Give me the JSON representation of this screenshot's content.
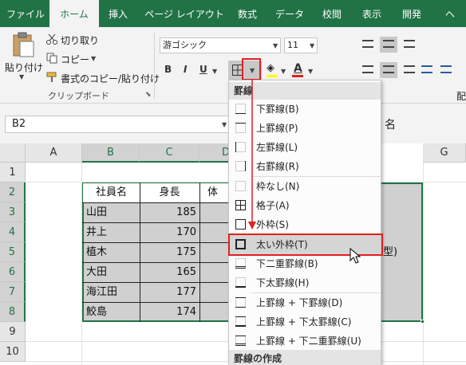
{
  "ribbon_tabs": [
    "ファイル",
    "ホーム",
    "挿入",
    "ページ レイアウト",
    "数式",
    "データ",
    "校閲",
    "表示",
    "開発",
    "ヘ"
  ],
  "clipboard": {
    "paste": "貼り付け",
    "cut": "切り取り",
    "copy": "コピー",
    "format_painter": "書式のコピー/貼り付け",
    "group_label": "クリップボード"
  },
  "font": {
    "name": "游ゴシック",
    "size": "11"
  },
  "font_buttons": {
    "bold": "B",
    "italic": "I",
    "underline": "U",
    "font_color_glyph": "A"
  },
  "name_box": "B2",
  "formula_bar_tail": "名",
  "right_edge_label": "配",
  "columns": [
    "A",
    "B",
    "C",
    "D",
    "G"
  ],
  "rows": [
    "1",
    "2",
    "3",
    "4",
    "5",
    "6",
    "7",
    "8",
    "9",
    "10"
  ],
  "table": {
    "headers": [
      "社員名",
      "身長",
      "体"
    ],
    "names": [
      "山田",
      "井上",
      "植木",
      "大田",
      "海江田",
      "鮫島"
    ],
    "heights": [
      "185",
      "170",
      "175",
      "165",
      "177",
      "174"
    ]
  },
  "sheet_text": {
    "cell_g5_fragment": "型)"
  },
  "border_menu": {
    "header": "罫線",
    "items": [
      {
        "label": "下罫線(B)",
        "icon": "border-bottom-icon"
      },
      {
        "label": "上罫線(P)",
        "icon": "border-top-icon"
      },
      {
        "label": "左罫線(L)",
        "icon": "border-left-icon"
      },
      {
        "label": "右罫線(R)",
        "icon": "border-right-icon"
      },
      {
        "label": "枠なし(N)",
        "icon": "no-border-icon"
      },
      {
        "label": "格子(A)",
        "icon": "all-borders-icon"
      },
      {
        "label": "外枠(S)",
        "icon": "outside-borders-icon"
      },
      {
        "label": "太い外枠(T)",
        "icon": "thick-outside-borders-icon"
      },
      {
        "label": "下二重罫線(B)",
        "icon": "bottom-double-border-icon"
      },
      {
        "label": "下太罫線(H)",
        "icon": "thick-bottom-border-icon"
      },
      {
        "label": "上罫線 + 下罫線(D)",
        "icon": "top-bottom-border-icon"
      },
      {
        "label": "上罫線 + 下太罫線(C)",
        "icon": "top-thick-bottom-border-icon"
      },
      {
        "label": "上罫線 + 下二重罫線(U)",
        "icon": "top-double-bottom-border-icon"
      }
    ],
    "highlighted": "太い外枠(T)",
    "footer": "罫線の作成"
  },
  "colors": {
    "excel_green": "#217346",
    "annotation_red": "#e02020"
  }
}
